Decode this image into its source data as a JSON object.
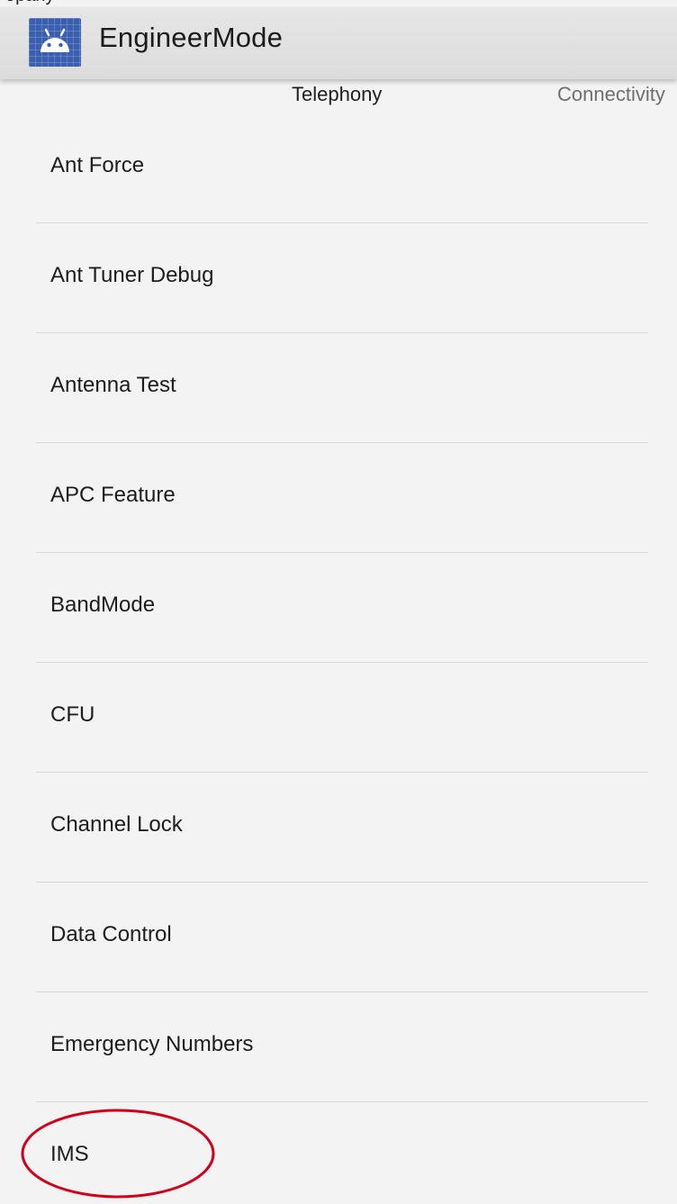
{
  "status_bar": {
    "partial_text": "opany"
  },
  "app_bar": {
    "title": "EngineerMode",
    "icon": "android-robot-icon",
    "icon_color": "#3a5fb0"
  },
  "tabs": [
    {
      "label": "Telephony",
      "selected": true
    },
    {
      "label": "Connectivity",
      "selected": false
    }
  ],
  "menu_items": [
    {
      "label": "Ant Force"
    },
    {
      "label": "Ant Tuner Debug"
    },
    {
      "label": "Antenna Test"
    },
    {
      "label": "APC Feature"
    },
    {
      "label": "BandMode"
    },
    {
      "label": "CFU"
    },
    {
      "label": "Channel Lock"
    },
    {
      "label": "Data Control"
    },
    {
      "label": "Emergency Numbers"
    },
    {
      "label": "IMS"
    }
  ],
  "annotation": {
    "shape": "ellipse",
    "color": "#d0021b",
    "target": "IMS"
  }
}
